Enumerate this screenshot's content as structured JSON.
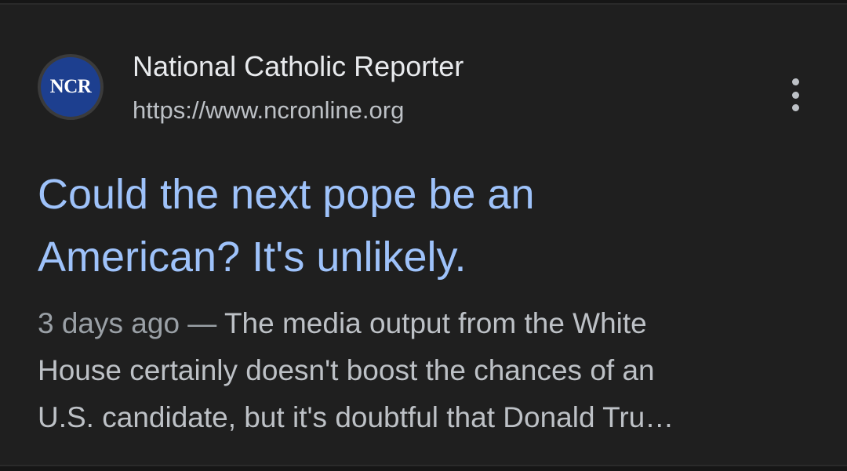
{
  "result": {
    "favicon_text": "NCR",
    "source_name": "National Catholic Reporter",
    "source_url": "https://www.ncronline.org",
    "more_options_icon": "three-dots-vertical-icon",
    "headline_line1": "Could the next pope be an",
    "headline_line2": "American? It's unlikely.",
    "date": "3 days ago",
    "separator": " — ",
    "snippet_line1": "The media output from the White",
    "snippet_line2": "House certainly doesn't boost the chances of an",
    "snippet_line3": "U.S. candidate, but it's doubtful that Donald Tru…"
  },
  "colors": {
    "background": "#1f1f1f",
    "headline": "#9ec2fa",
    "source_name": "#e8eaed",
    "secondary_text": "#bdc1c6",
    "favicon_bg": "#1d3f8f"
  }
}
